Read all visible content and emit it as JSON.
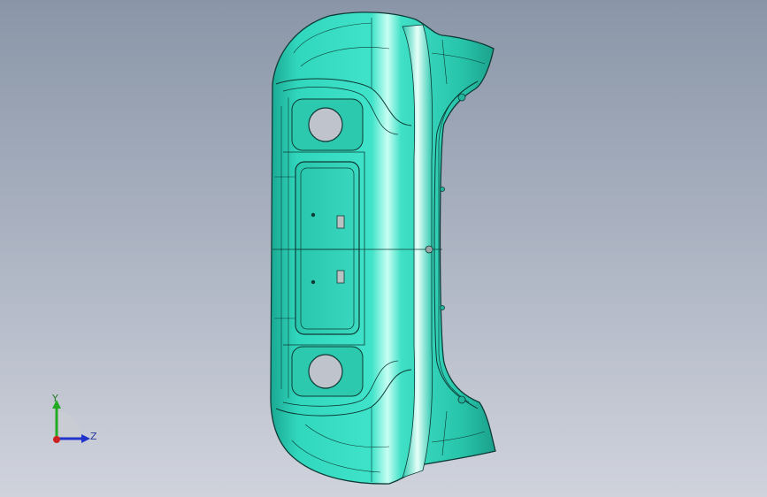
{
  "viewport": {
    "background_top": "#8a96a8",
    "background_bottom": "#d0d3dc"
  },
  "model": {
    "part": "bumper-cover-shell",
    "surface_color": "#2fd3b8",
    "edge_color": "#0d3a35"
  },
  "triad": {
    "y_label": "Y",
    "z_label": "Z",
    "y_color": "#22aa22",
    "z_color": "#2233cc",
    "x_color": "#cc2222"
  }
}
